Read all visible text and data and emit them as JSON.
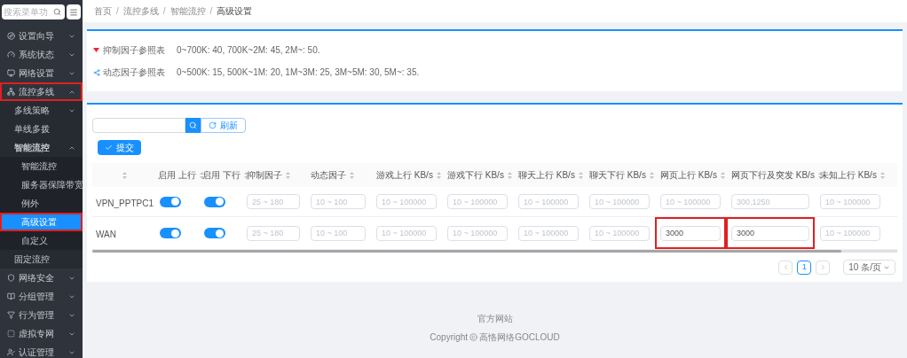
{
  "sidebar": {
    "search_placeholder": "搜索菜单功",
    "items": [
      {
        "label": "设置向导",
        "selected": false,
        "expanded": false,
        "highlighted": false
      },
      {
        "label": "系统状态",
        "selected": false,
        "expanded": false,
        "highlighted": false
      },
      {
        "label": "网络设置",
        "selected": false,
        "expanded": false,
        "highlighted": false
      },
      {
        "label": "流控多线",
        "selected": false,
        "expanded": true,
        "highlighted": true,
        "children": [
          {
            "label": "多线策略",
            "selected": false,
            "expanded": false,
            "highlighted": false
          },
          {
            "label": "单线多拨",
            "selected": false,
            "highlighted": false
          },
          {
            "label": "智能流控",
            "selected": false,
            "expanded": true,
            "highlighted": false,
            "children": [
              {
                "label": "智能流控",
                "selected": false,
                "highlighted": false
              },
              {
                "label": "服务器保障带宽",
                "selected": false,
                "highlighted": false
              },
              {
                "label": "例外",
                "selected": false,
                "highlighted": false
              },
              {
                "label": "高级设置",
                "selected": true,
                "highlighted": true
              },
              {
                "label": "自定义",
                "selected": false,
                "highlighted": false
              }
            ]
          },
          {
            "label": "固定流控",
            "selected": false,
            "highlighted": false
          }
        ]
      },
      {
        "label": "网络安全",
        "selected": false,
        "expanded": false,
        "highlighted": false
      },
      {
        "label": "分组管理",
        "selected": false,
        "expanded": false,
        "highlighted": false
      },
      {
        "label": "行为管理",
        "selected": false,
        "expanded": false,
        "highlighted": false
      },
      {
        "label": "虚拟专网",
        "selected": false,
        "expanded": false,
        "highlighted": false
      },
      {
        "label": "认证管理",
        "selected": false,
        "expanded": false,
        "highlighted": false
      }
    ]
  },
  "breadcrumb": {
    "separator": "/",
    "items": [
      "首页",
      "流控多线",
      "智能流控",
      "高级设置"
    ]
  },
  "reference": [
    {
      "label": "抑制因子参照表",
      "text": "0~700K: 40, 700K~2M: 45, 2M~: 50."
    },
    {
      "label": "动态因子参照表",
      "text": "0~500K: 15, 500K~1M: 20, 1M~3M: 25, 3M~5M: 30, 5M~: 35."
    }
  ],
  "toolbar": {
    "refresh": "刷新",
    "submit": "提交"
  },
  "table": {
    "columns": [
      "",
      "启用 上行",
      "启用 下行",
      "抑制因子",
      "动态因子",
      "游戏上行 KB/s",
      "游戏下行 KB/s",
      "聊天上行 KB/s",
      "聊天下行 KB/s",
      "网页上行 KB/s",
      "网页下行及突发 KB/s",
      "未知上行 KB/s"
    ],
    "rows": [
      {
        "cells": [
          {
            "kind": "text",
            "text": "VPN_PPTPC1"
          },
          {
            "kind": "toggle",
            "on": true
          },
          {
            "kind": "toggle",
            "on": true
          },
          {
            "kind": "input",
            "placeholder": "25 ~ 180",
            "highlighted": false
          },
          {
            "kind": "input",
            "placeholder": "10 ~ 100",
            "highlighted": false
          },
          {
            "kind": "input",
            "placeholder": "10 ~ 100000",
            "highlighted": false
          },
          {
            "kind": "input",
            "placeholder": "10 ~ 100000",
            "highlighted": false
          },
          {
            "kind": "input",
            "placeholder": "10 ~ 100000",
            "highlighted": false
          },
          {
            "kind": "input",
            "placeholder": "10 ~ 100000",
            "highlighted": false
          },
          {
            "kind": "input",
            "placeholder": "10 ~ 100000",
            "highlighted": false
          },
          {
            "kind": "input",
            "placeholder": "300,1250",
            "highlighted": false
          },
          {
            "kind": "input",
            "placeholder": "10 ~ 100000",
            "highlighted": false
          }
        ]
      },
      {
        "cells": [
          {
            "kind": "text",
            "text": "WAN"
          },
          {
            "kind": "toggle",
            "on": true
          },
          {
            "kind": "toggle",
            "on": true
          },
          {
            "kind": "input",
            "placeholder": "25 ~ 180",
            "highlighted": false
          },
          {
            "kind": "input",
            "placeholder": "10 ~ 100",
            "highlighted": false
          },
          {
            "kind": "input",
            "placeholder": "10 ~ 100000",
            "highlighted": false
          },
          {
            "kind": "input",
            "placeholder": "10 ~ 100000",
            "highlighted": false
          },
          {
            "kind": "input",
            "placeholder": "10 ~ 100000",
            "highlighted": false
          },
          {
            "kind": "input",
            "placeholder": "10 ~ 100000",
            "highlighted": false
          },
          {
            "kind": "input",
            "value": "3000",
            "highlighted": true
          },
          {
            "kind": "input",
            "value": "3000",
            "highlighted": true
          },
          {
            "kind": "input",
            "placeholder": "10 ~ 100000",
            "highlighted": false
          }
        ]
      }
    ]
  },
  "pagination": {
    "pages": [
      {
        "label": "1",
        "selected": true
      }
    ],
    "page_size": "10 条/页"
  },
  "footer": {
    "link": "官方网站",
    "copyright": "Copyright",
    "brand": "高恪网络GOCLOUD"
  }
}
